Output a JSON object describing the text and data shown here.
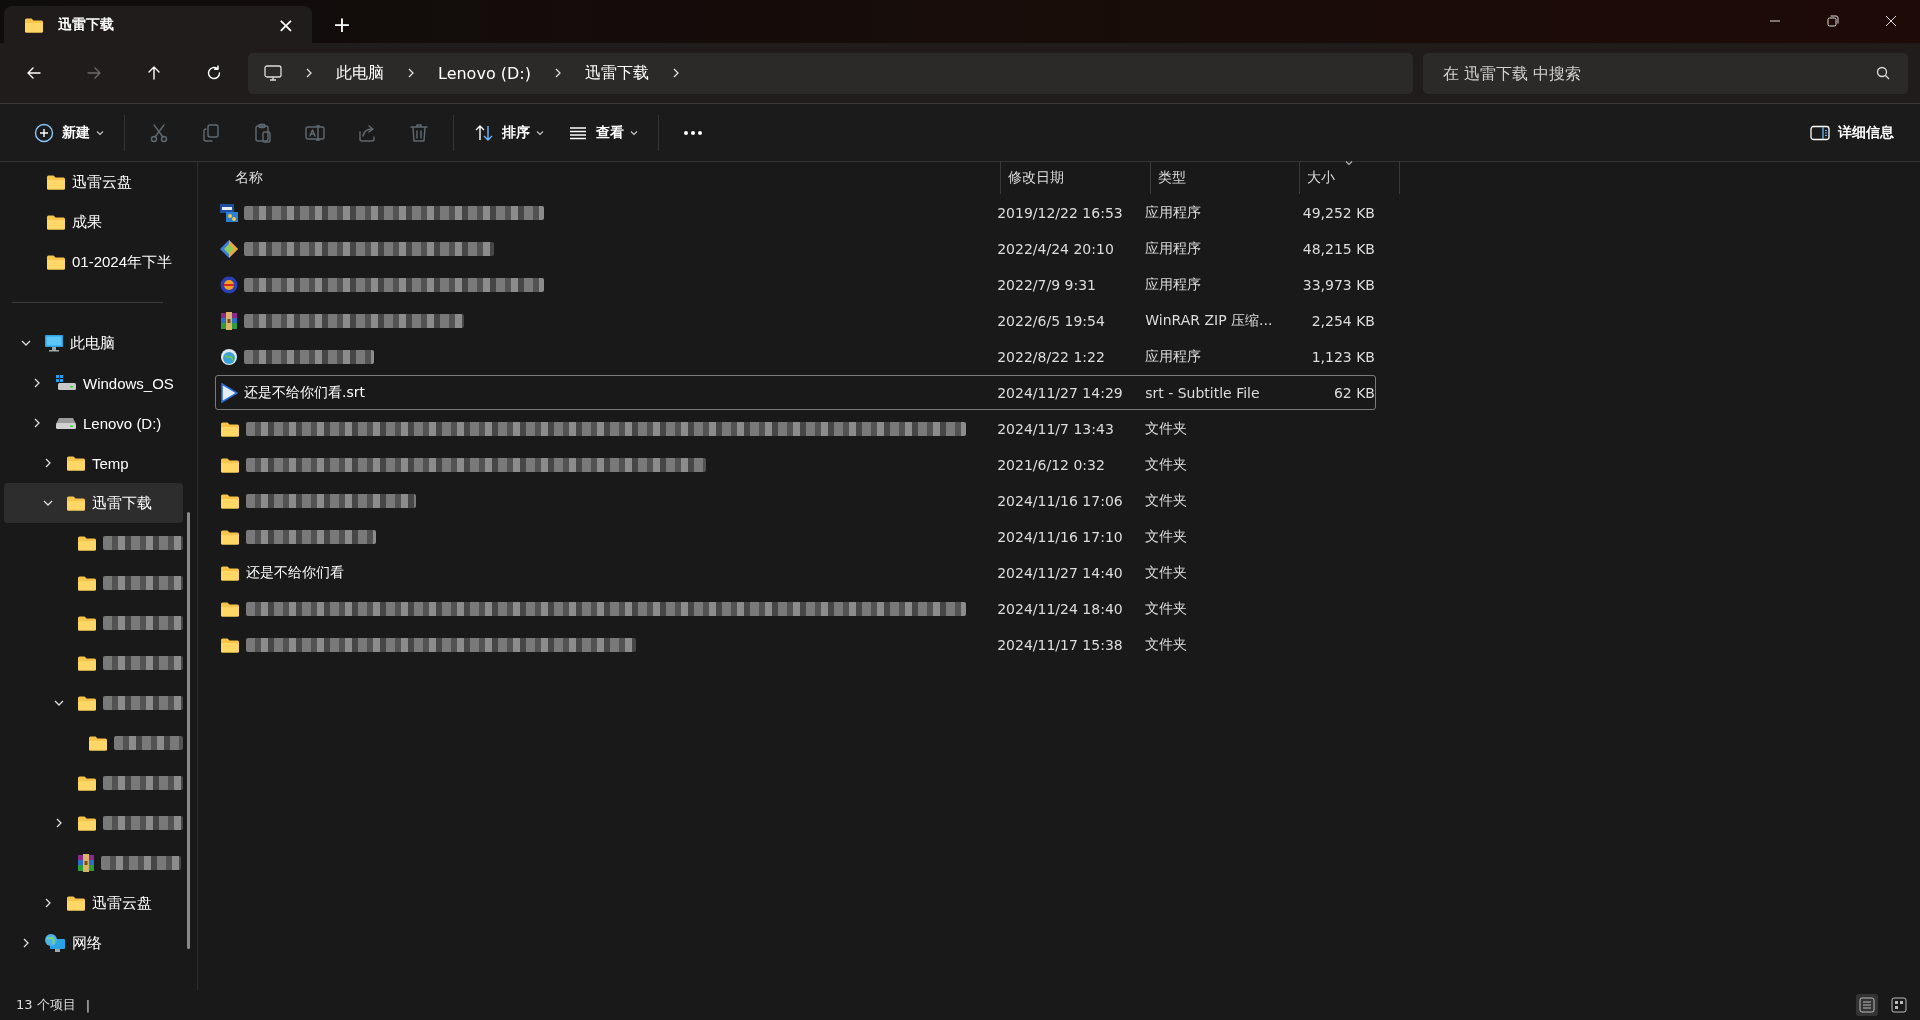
{
  "window": {
    "tab": {
      "title": "迅雷下载",
      "close": "×"
    },
    "new_tab": "+"
  },
  "navigation": {
    "buttons": [
      {
        "kind": "back",
        "disabled": false
      },
      {
        "kind": "forward",
        "disabled": true
      },
      {
        "kind": "up",
        "disabled": false
      },
      {
        "kind": "refresh",
        "disabled": false
      }
    ],
    "breadcrumb": [
      "此电脑",
      "Lenovo (D:)",
      "迅雷下载"
    ],
    "search": {
      "placeholder": "在 迅雷下载 中搜索"
    }
  },
  "toolbar": {
    "actions": [
      {
        "kind": "new",
        "label": "新建",
        "disabled": false
      },
      {
        "kind": "cut",
        "disabled": true
      },
      {
        "kind": "copy",
        "disabled": true
      },
      {
        "kind": "paste",
        "disabled": true
      },
      {
        "kind": "rename",
        "disabled": true
      },
      {
        "kind": "share",
        "disabled": true
      },
      {
        "kind": "delete",
        "disabled": true
      },
      {
        "kind": "sort",
        "label": "排序",
        "disabled": false
      },
      {
        "kind": "view",
        "label": "查看",
        "disabled": false
      },
      {
        "kind": "more",
        "disabled": false
      }
    ],
    "details": {
      "label": "详细信息"
    }
  },
  "sidebar": {
    "quick_access": [
      {
        "label": "迅雷云盘",
        "kind": "folder"
      },
      {
        "label": "成果",
        "kind": "folder"
      },
      {
        "label": "01-2024年下半",
        "kind": "folder"
      }
    ],
    "tree": [
      {
        "label": "此电脑",
        "kind": "pc",
        "blurred": false,
        "expandable": true,
        "expanded": true,
        "selected": false,
        "children": [
          {
            "label": "Windows_OS",
            "kind": "osdrive",
            "blurred": false,
            "expandable": true,
            "expanded": false,
            "selected": false
          },
          {
            "label": "Lenovo (D:)",
            "kind": "drive",
            "blurred": false,
            "expandable": true,
            "expanded": false,
            "selected": false,
            "children": [
              {
                "label": "Temp",
                "kind": "folder",
                "blurred": false,
                "expandable": true,
                "expanded": false,
                "selected": false
              },
              {
                "label": "迅雷下载",
                "kind": "folder",
                "blurred": false,
                "expandable": true,
                "expanded": true,
                "selected": true,
                "children": [
                  {
                    "kind": "folder",
                    "blurred": true,
                    "expandable": false,
                    "selected": false
                  },
                  {
                    "kind": "folder",
                    "blurred": true,
                    "expandable": false,
                    "selected": false
                  },
                  {
                    "kind": "folder",
                    "blurred": true,
                    "expandable": false,
                    "selected": false
                  },
                  {
                    "kind": "folder",
                    "blurred": true,
                    "expandable": false,
                    "selected": false
                  },
                  {
                    "kind": "folder",
                    "blurred": true,
                    "expandable": true,
                    "expanded": true,
                    "selected": false,
                    "children": [
                      {
                        "kind": "folder",
                        "blurred": true,
                        "expandable": false,
                        "selected": false
                      }
                    ]
                  },
                  {
                    "kind": "folder",
                    "blurred": true,
                    "expandable": false,
                    "selected": false
                  },
                  {
                    "kind": "folder",
                    "blurred": true,
                    "expandable": true,
                    "expanded": false,
                    "selected": false
                  },
                  {
                    "kind": "archive",
                    "blurred": true,
                    "expandable": false,
                    "selected": false
                  }
                ]
              },
              {
                "label": "迅雷云盘",
                "kind": "folder",
                "blurred": false,
                "expandable": true,
                "expanded": false,
                "selected": false
              }
            ]
          }
        ]
      },
      {
        "label": "网络",
        "kind": "network",
        "blurred": false,
        "expandable": true,
        "expanded": false,
        "selected": false
      }
    ]
  },
  "table": {
    "columns": [
      {
        "label": "名称",
        "sorted": false
      },
      {
        "label": "修改日期",
        "sorted": false
      },
      {
        "label": "类型",
        "sorted": false
      },
      {
        "label": "大小",
        "sorted": true
      }
    ],
    "rows": [
      {
        "kind": "dev",
        "blurred": true,
        "selected": false,
        "date": "2019/12/22 16:53",
        "type": "应用程序",
        "size": "49,252 KB"
      },
      {
        "kind": "diamond",
        "blurred": true,
        "selected": false,
        "date": "2022/4/24 20:10",
        "type": "应用程序",
        "size": "48,215 KB"
      },
      {
        "kind": "disc",
        "blurred": true,
        "selected": false,
        "date": "2022/7/9 9:31",
        "type": "应用程序",
        "size": "33,973 KB"
      },
      {
        "kind": "archive",
        "blurred": true,
        "selected": false,
        "date": "2022/6/5 19:54",
        "type": "WinRAR ZIP 压缩...",
        "size": "2,254 KB"
      },
      {
        "kind": "globe",
        "blurred": true,
        "selected": false,
        "date": "2022/8/22 1:22",
        "type": "应用程序",
        "size": "1,123 KB"
      },
      {
        "kind": "play",
        "blurred": false,
        "name": "还是不给你们看.srt",
        "selected": true,
        "date": "2024/11/27 14:29",
        "type": "srt - Subtitle File",
        "size": "62 KB"
      },
      {
        "kind": "folder",
        "blurred": true,
        "selected": false,
        "date": "2024/11/7 13:43",
        "type": "文件夹"
      },
      {
        "kind": "folder",
        "blurred": true,
        "selected": false,
        "date": "2021/6/12 0:32",
        "type": "文件夹"
      },
      {
        "kind": "folder",
        "blurred": true,
        "selected": false,
        "date": "2024/11/16 17:06",
        "type": "文件夹"
      },
      {
        "kind": "folder",
        "blurred": true,
        "selected": false,
        "date": "2024/11/16 17:10",
        "type": "文件夹"
      },
      {
        "kind": "folder",
        "blurred": false,
        "name": "还是不给你们看",
        "selected": false,
        "date": "2024/11/27 14:40",
        "type": "文件夹"
      },
      {
        "kind": "folder",
        "blurred": true,
        "selected": false,
        "date": "2024/11/24 18:40",
        "type": "文件夹"
      },
      {
        "kind": "folder",
        "blurred": true,
        "selected": false,
        "date": "2024/11/17 15:38",
        "type": "文件夹"
      }
    ]
  },
  "status_bar": {
    "count": "13 个项目",
    "separator": "|"
  }
}
